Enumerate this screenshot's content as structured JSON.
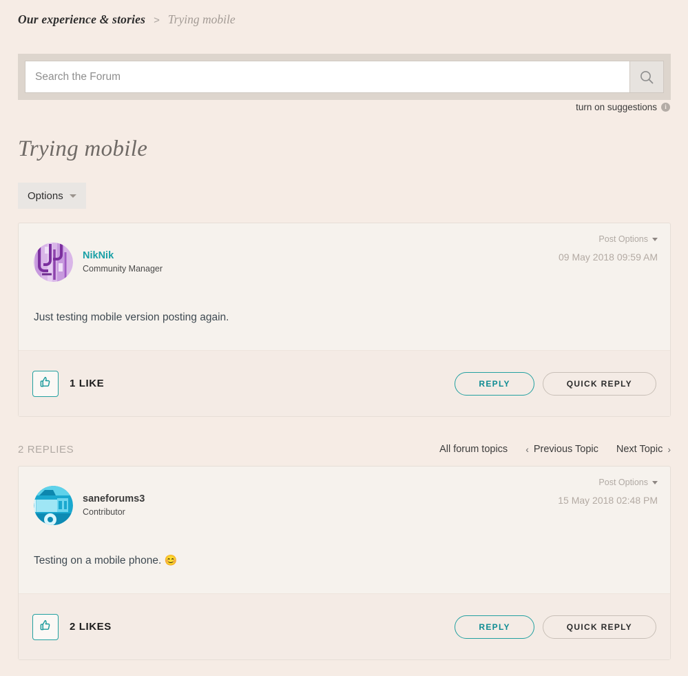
{
  "breadcrumb": {
    "root": "Our experience & stories",
    "separator": ">",
    "current": "Trying mobile"
  },
  "search": {
    "placeholder": "Search the Forum",
    "value": "",
    "icon": "search-icon",
    "suggestions_label": "turn on suggestions",
    "info_icon_char": "i"
  },
  "topic": {
    "title": "Trying mobile",
    "options_label": "Options"
  },
  "replies_bar": {
    "count_label": "2 REPLIES",
    "all_topics": "All forum topics",
    "previous_topic": "Previous Topic",
    "next_topic": "Next Topic",
    "prev_chevron": "‹",
    "next_chevron": "›"
  },
  "post_options_label": "Post Options",
  "actions": {
    "reply": "REPLY",
    "quick_reply": "QUICK REPLY"
  },
  "colors": {
    "page_background": "#f6ece5",
    "card_background": "#f6f2ed",
    "card_footer": "#f4ebe5",
    "accent_teal": "#22a0a0",
    "author_link": "#19a0a6",
    "muted_text": "#b0a9a3",
    "search_frame": "#ddd5cd"
  },
  "posts": [
    {
      "author": "NikNik",
      "author_color": "teal",
      "rank": "Community Manager",
      "date": "09 May 2018 09:59 AM",
      "body": "Just testing mobile version posting again.",
      "emoji": "",
      "like_count_label": "1 LIKE",
      "avatar": "purple-abstract-avatar"
    },
    {
      "author": "saneforums3",
      "author_color": "dark",
      "rank": "Contributor",
      "date": "15 May 2018 02:48 PM",
      "body": "Testing on a mobile phone.",
      "emoji": "😊",
      "like_count_label": "2 LIKES",
      "avatar": "blue-abstract-avatar"
    }
  ]
}
